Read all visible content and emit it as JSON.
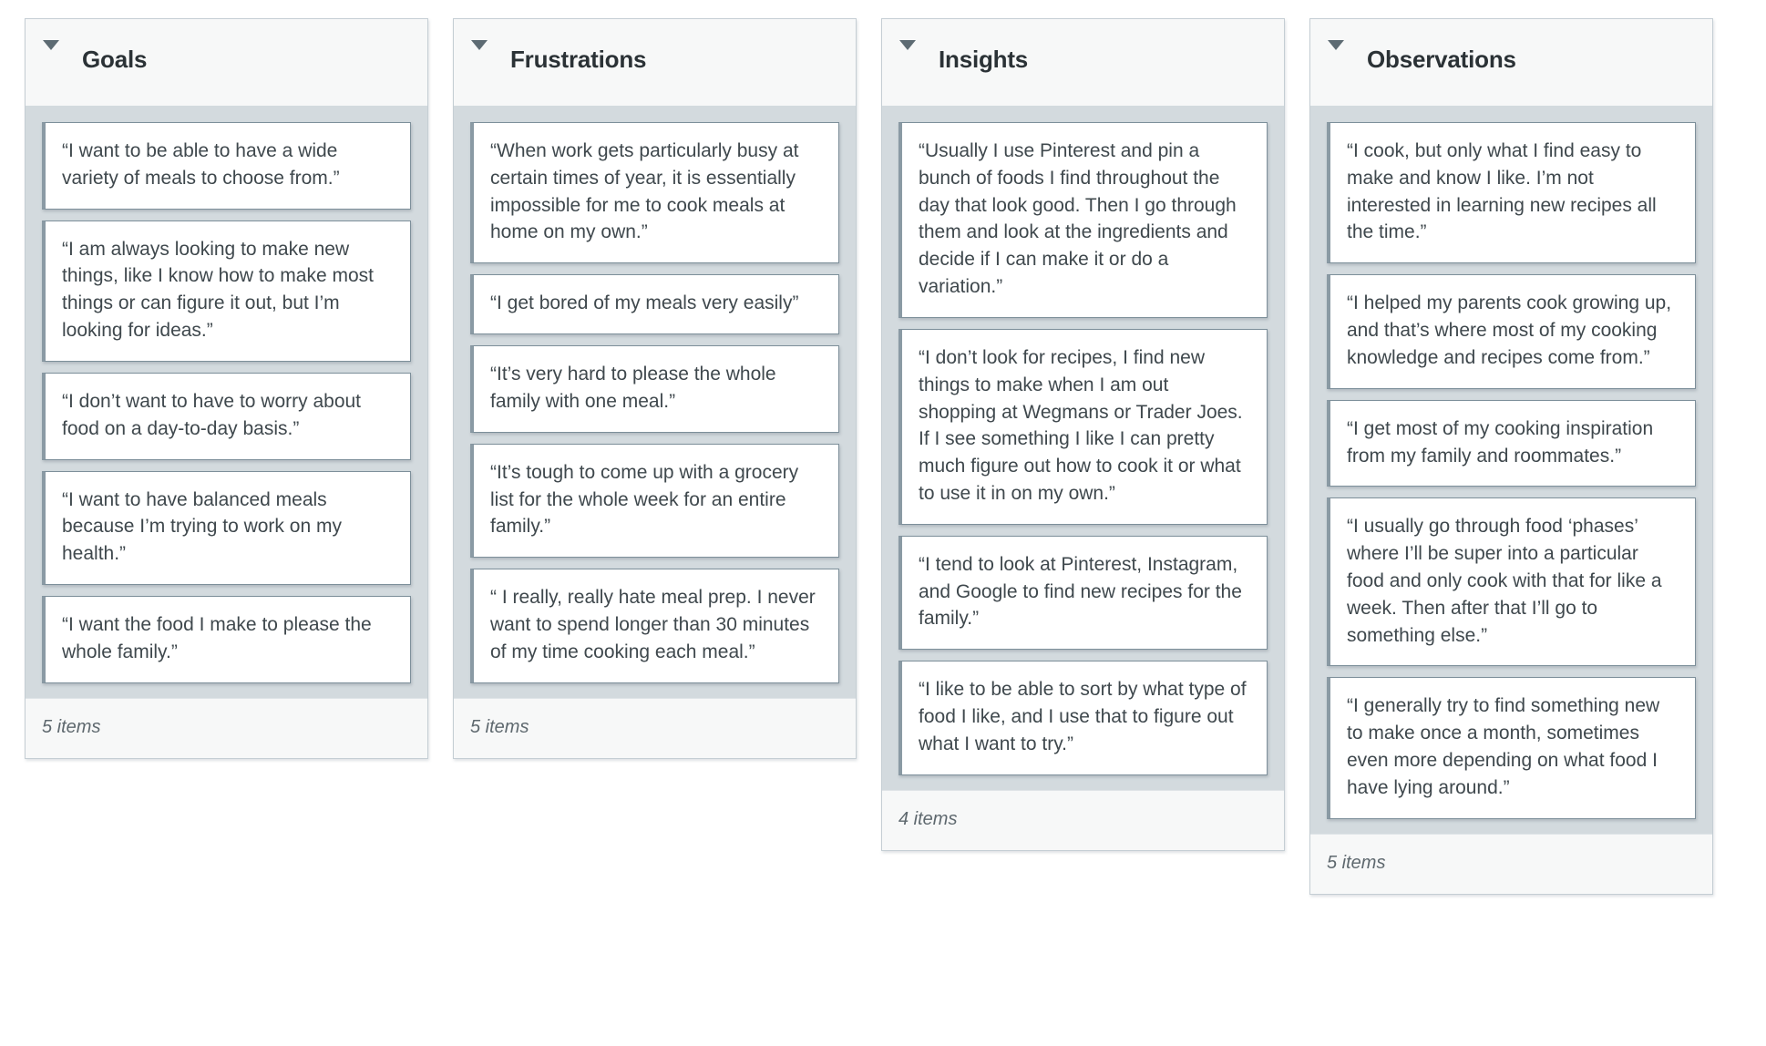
{
  "board": {
    "collapse_icon": "caret-down-icon",
    "columns": [
      {
        "title": "Goals",
        "footer_count": "5 items",
        "cards": [
          {
            "text": "“I want to be able to have a wide variety of meals to choose from.”"
          },
          {
            "text": "“I am always looking to make new things, like I know how to make most things or can figure it out, but I’m looking for ideas.”"
          },
          {
            "text": "“I don’t want to have to worry about food on a day-to-day basis.”"
          },
          {
            "text": "“I want to have balanced meals because I’m trying to work on my health.”"
          },
          {
            "text": "“I want the food I make to please the whole family.”"
          }
        ]
      },
      {
        "title": "Frustrations",
        "footer_count": "5 items",
        "cards": [
          {
            "text": "“When work gets particularly busy at certain times of year, it is essentially impossible for me to cook meals at home on my own.”"
          },
          {
            "text": "“I get bored of my meals very easily”"
          },
          {
            "text": "“It’s very hard to please the whole family with one meal.”"
          },
          {
            "text": "“It’s tough to come up with a grocery list for the whole week for an entire family.”"
          },
          {
            "text": "“ I really, really hate meal prep. I never want to spend longer than 30 minutes of my time cooking each meal.”"
          }
        ]
      },
      {
        "title": "Insights",
        "footer_count": "4 items",
        "cards": [
          {
            "text": "“Usually I use Pinterest and pin a bunch of foods I find throughout the day that look good. Then I go through them and look at the ingredients and decide if I can make it or do a variation.”"
          },
          {
            "text": "“I don’t look for recipes, I find new things to make when I am out shopping at Wegmans or Trader Joes. If I see something I like I can pretty much figure out how to cook it or what to use it in on my own.”"
          },
          {
            "text": "“I tend to look at Pinterest, Instagram, and Google to find new recipes for the family.”"
          },
          {
            "text": "“I like to be able to sort by what type of food I like, and I use that to figure out what I want to try.”"
          }
        ]
      },
      {
        "title": "Observations",
        "footer_count": "5 items",
        "cards": [
          {
            "text": "“I cook, but only what I find easy to make and know I like. I’m not interested in learning new recipes all the time.”"
          },
          {
            "text": "“I helped my parents cook growing up, and that’s where most of my cooking knowledge and recipes come from.”"
          },
          {
            "text": "“I get most of my cooking inspiration from my family and roommates.”"
          },
          {
            "text": "“I usually go through food ‘phases’ where I’ll be super into a particular food and only cook with that for like a week. Then after that I’ll go to something else.”"
          },
          {
            "text": "“I generally try to find something new to make once a month, sometimes even more depending on what food I have lying around.”"
          }
        ]
      }
    ]
  }
}
